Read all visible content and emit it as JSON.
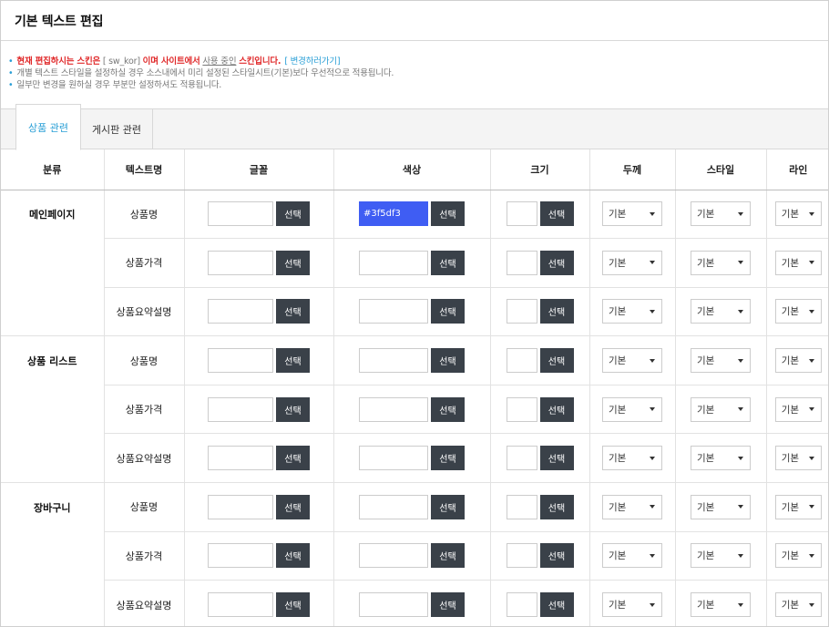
{
  "title": "기본 텍스트 편집",
  "notes": {
    "line1_red1": "현재 편집하시는 스킨은",
    "line1_skin": "[ sw_kor]",
    "line1_red2": "이며 사이트에서",
    "line1_under": "사용 중인",
    "line1_red3": "스킨입니다.",
    "line1_link": "[ 변경하러가기]",
    "line2": "개별 텍스트 스타일을 설정하실 경우 소스내에서 미리 설정된 스타일시트(기본)보다 우선적으로 적용됩니다.",
    "line3": "일부만 변경을 원하실 경우 부분만 설정하셔도 적용됩니다."
  },
  "tabs": [
    "상품 관련",
    "게시판 관련"
  ],
  "headers": [
    "분류",
    "텍스트명",
    "글꼴",
    "색상",
    "크기",
    "두께",
    "스타일",
    "라인"
  ],
  "button_label": "선택",
  "select_value": "기본",
  "accent_color": "#2a9fd6",
  "groups": [
    {
      "category": "메인페이지",
      "rows": [
        {
          "name": "상품명",
          "font": "",
          "color": "#3f5df3",
          "size": ""
        },
        {
          "name": "상품가격",
          "font": "",
          "color": "",
          "size": ""
        },
        {
          "name": "상품요약설명",
          "font": "",
          "color": "",
          "size": ""
        }
      ]
    },
    {
      "category": "상품 리스트",
      "rows": [
        {
          "name": "상품명",
          "font": "",
          "color": "",
          "size": ""
        },
        {
          "name": "상품가격",
          "font": "",
          "color": "",
          "size": ""
        },
        {
          "name": "상품요약설명",
          "font": "",
          "color": "",
          "size": ""
        }
      ]
    },
    {
      "category": "장바구니",
      "rows": [
        {
          "name": "상품명",
          "font": "",
          "color": "",
          "size": ""
        },
        {
          "name": "상품가격",
          "font": "",
          "color": "",
          "size": ""
        },
        {
          "name": "상품요약설명",
          "font": "",
          "color": "",
          "size": ""
        }
      ]
    }
  ]
}
